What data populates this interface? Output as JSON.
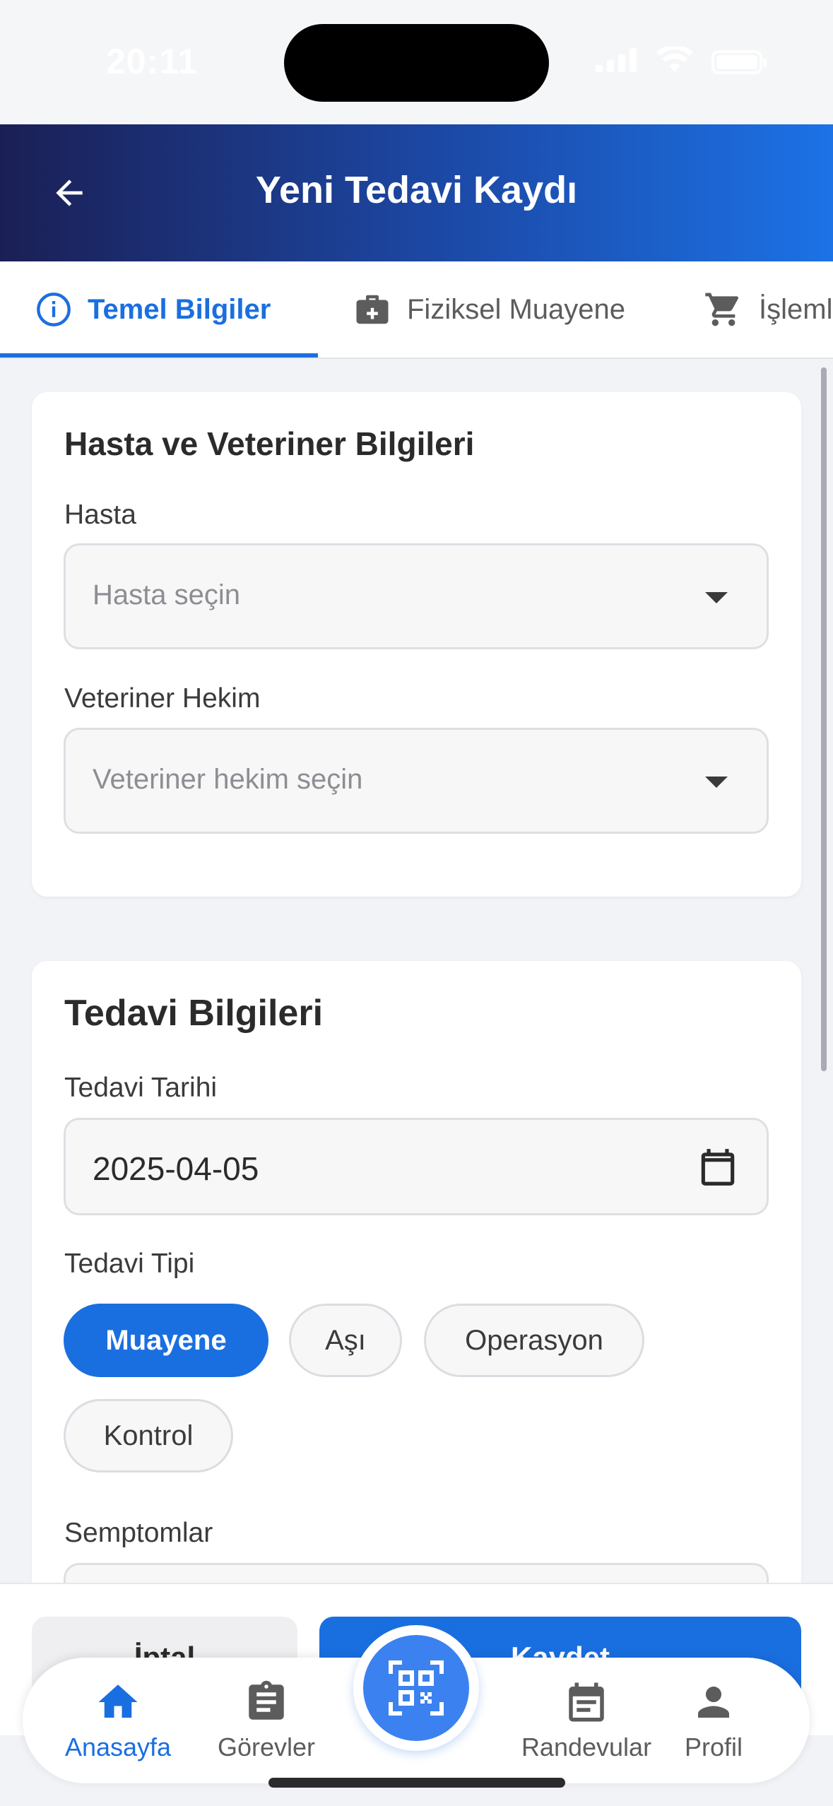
{
  "status_bar": {
    "time": "20:11"
  },
  "header": {
    "title": "Yeni Tedavi Kaydı"
  },
  "tabs": [
    {
      "label": "Temel Bilgiler",
      "icon": "info-icon",
      "active": true
    },
    {
      "label": "Fiziksel Muayene",
      "icon": "medical-bag-icon",
      "active": false
    },
    {
      "label": "İşlemler",
      "icon": "cart-icon",
      "active": false
    }
  ],
  "patient_card": {
    "title": "Hasta ve Veteriner Bilgileri",
    "patient_label": "Hasta",
    "patient_placeholder": "Hasta seçin",
    "vet_label": "Veteriner Hekim",
    "vet_placeholder": "Veteriner hekim seçin"
  },
  "treatment_card": {
    "title": "Tedavi Bilgileri",
    "date_label": "Tedavi Tarihi",
    "date_value": "2025-04-05",
    "type_label": "Tedavi Tipi",
    "types": [
      "Muayene",
      "Aşı",
      "Operasyon",
      "Kontrol"
    ],
    "selected_type": "Muayene",
    "symptoms_label": "Semptomlar"
  },
  "actions": {
    "cancel": "İptal",
    "save": "Kaydet"
  },
  "nav": {
    "items": [
      {
        "label": "Anasayfa",
        "icon": "home-icon",
        "active": true
      },
      {
        "label": "Görevler",
        "icon": "clipboard-icon",
        "active": false
      },
      {
        "label": "Randevular",
        "icon": "calendar-list-icon",
        "active": false
      },
      {
        "label": "Profil",
        "icon": "person-icon",
        "active": false
      }
    ],
    "center_icon": "qr-scan-icon"
  },
  "colors": {
    "accent": "#1a6fe0",
    "header_start": "#1b1f55",
    "header_end": "#1c72e6"
  }
}
